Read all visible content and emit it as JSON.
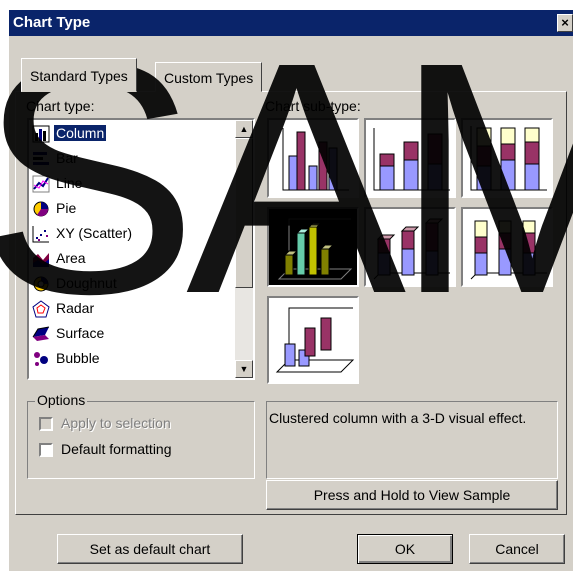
{
  "window": {
    "title": "Chart Type",
    "close_glyph": "×"
  },
  "tabs": [
    {
      "label": "Standard Types",
      "active": true
    },
    {
      "label": "Custom Types",
      "active": false
    }
  ],
  "chart_type": {
    "label": "Chart type:",
    "items": [
      {
        "label": "Column",
        "icon": "column-chart-icon",
        "selected": true
      },
      {
        "label": "Bar",
        "icon": "bar-chart-icon"
      },
      {
        "label": "Line",
        "icon": "line-chart-icon"
      },
      {
        "label": "Pie",
        "icon": "pie-chart-icon"
      },
      {
        "label": "XY (Scatter)",
        "icon": "scatter-chart-icon"
      },
      {
        "label": "Area",
        "icon": "area-chart-icon"
      },
      {
        "label": "Doughnut",
        "icon": "doughnut-chart-icon"
      },
      {
        "label": "Radar",
        "icon": "radar-chart-icon"
      },
      {
        "label": "Surface",
        "icon": "surface-chart-icon"
      },
      {
        "label": "Bubble",
        "icon": "bubble-chart-icon"
      }
    ]
  },
  "sub_type": {
    "label": "Chart sub-type:",
    "selected_index": 3
  },
  "options": {
    "title": "Options",
    "apply_label": "Apply to selection",
    "apply_checked": false,
    "apply_enabled": false,
    "default_label": "Default formatting",
    "default_checked": false
  },
  "description": "Clustered column with a 3-D visual effect.",
  "buttons": {
    "preview": "Press and Hold to View Sample",
    "set_default": "Set as default chart",
    "ok": "OK",
    "cancel": "Cancel"
  },
  "watermark": "SAM",
  "colors": {
    "title_bar": "#0a246a",
    "face": "#d4d0c8",
    "series_purple": "#993366",
    "series_lilac": "#9999ff",
    "series_cream": "#ffffcc"
  }
}
